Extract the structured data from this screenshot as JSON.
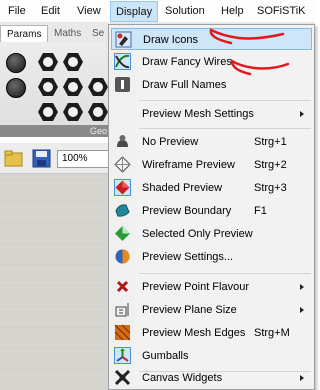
{
  "menubar": {
    "items": [
      "File",
      "Edit",
      "View",
      "Display",
      "Solution",
      "Help",
      "SOFiSTiK"
    ],
    "active": "Display"
  },
  "tabs": [
    "Params",
    "Maths",
    "Se"
  ],
  "toolbar": {
    "group_label": "Geo",
    "zoom_value": "100%"
  },
  "menu": {
    "items": [
      {
        "label": "Draw Icons",
        "icon": "draw-icons-icon",
        "highlighted": true
      },
      {
        "label": "Draw Fancy Wires",
        "icon": "fancy-wires-icon",
        "checked": true
      },
      {
        "label": "Draw Full Names",
        "icon": "full-names-icon"
      },
      {
        "label": "Preview Mesh Settings",
        "submenu": true
      },
      {
        "label": "No Preview",
        "shortcut": "Strg+1",
        "icon": "no-preview-icon"
      },
      {
        "label": "Wireframe Preview",
        "shortcut": "Strg+2",
        "icon": "wireframe-icon"
      },
      {
        "label": "Shaded Preview",
        "shortcut": "Strg+3",
        "icon": "shaded-icon",
        "checked": true
      },
      {
        "label": "Preview Boundary",
        "shortcut": "F1",
        "icon": "boundary-icon"
      },
      {
        "label": "Selected Only Preview",
        "icon": "selected-only-icon"
      },
      {
        "label": "Preview Settings...",
        "icon": "preview-settings-icon"
      },
      {
        "label": "Preview Point Flavour",
        "submenu": true,
        "icon": "point-flavour-icon"
      },
      {
        "label": "Preview Plane Size",
        "submenu": true,
        "icon": "plane-size-icon"
      },
      {
        "label": "Preview Mesh Edges",
        "shortcut": "Strg+M",
        "icon": "mesh-edges-icon"
      },
      {
        "label": "Gumballs",
        "icon": "gumballs-icon",
        "checked": true
      },
      {
        "label": "Canvas Widgets",
        "submenu": true,
        "icon": "widgets-icon"
      }
    ]
  },
  "colors": {
    "highlight": "#cfe5f8",
    "highlight_border": "#7fbbea",
    "annotation": "#e0191b"
  }
}
